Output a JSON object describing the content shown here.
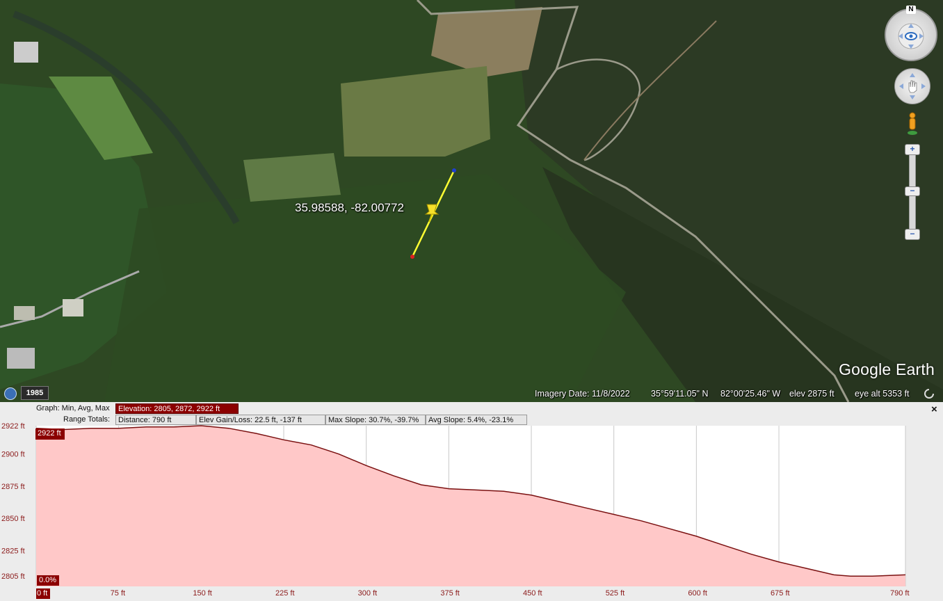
{
  "map": {
    "pin_label": "35.98588, -82.00772",
    "logo": "Google Earth",
    "history_year": "1985",
    "icons": [
      "clock-history-icon",
      "compass-icon",
      "pan-hand-icon",
      "pegman-icon",
      "zoom-in-icon",
      "zoom-out-icon",
      "pushpin-icon",
      "loading-icon"
    ],
    "compass_letter": "N",
    "status": {
      "imagery_date": "Imagery Date: 11/8/2022",
      "lat": "35°59'11.05\" N",
      "lon": "82°00'25.46\" W",
      "elev": "elev  2875 ft",
      "eye_alt": "eye alt   5353 ft"
    }
  },
  "profile": {
    "graph_label": "Graph: Min, Avg, Max",
    "elevation_stats": "Elevation: 2805, 2872, 2922 ft",
    "range_totals_label": "Range Totals:",
    "distance": "Distance: 790 ft",
    "elev_gain_loss": "Elev Gain/Loss: 22.5 ft, -137 ft",
    "max_slope": "Max Slope: 30.7%, -39.7%",
    "avg_slope": "Avg Slope: 5.4%, -23.1%",
    "close_icon": "×",
    "max_marker": "2922 ft",
    "slope_marker": "0.0%",
    "start_marker": "0 ft",
    "colors": {
      "fill": "#ffc8c8",
      "line": "#8b1a1a",
      "highlight": "#8b0000"
    }
  },
  "chart_data": {
    "type": "area",
    "xlabel": "",
    "ylabel": "",
    "xlim": [
      0,
      790
    ],
    "ylim": [
      2797,
      2922
    ],
    "y_ticks": [
      {
        "value": 2922,
        "label": "2922 ft"
      },
      {
        "value": 2900,
        "label": "2900 ft"
      },
      {
        "value": 2875,
        "label": "2875 ft"
      },
      {
        "value": 2850,
        "label": "2850 ft"
      },
      {
        "value": 2825,
        "label": "2825 ft"
      },
      {
        "value": 2805,
        "label": "2805 ft"
      }
    ],
    "x_ticks": [
      {
        "value": 0,
        "label": "0 ft"
      },
      {
        "value": 75,
        "label": "75 ft"
      },
      {
        "value": 150,
        "label": "150 ft"
      },
      {
        "value": 225,
        "label": "225 ft"
      },
      {
        "value": 300,
        "label": "300 ft"
      },
      {
        "value": 375,
        "label": "375 ft"
      },
      {
        "value": 450,
        "label": "450 ft"
      },
      {
        "value": 525,
        "label": "525 ft"
      },
      {
        "value": 600,
        "label": "600 ft"
      },
      {
        "value": 675,
        "label": "675 ft"
      },
      {
        "value": 790,
        "label": "790 ft"
      }
    ],
    "x": [
      0,
      25,
      50,
      75,
      100,
      125,
      150,
      175,
      200,
      225,
      250,
      275,
      300,
      325,
      350,
      375,
      400,
      425,
      450,
      475,
      500,
      525,
      550,
      575,
      600,
      625,
      650,
      675,
      700,
      725,
      740,
      760,
      790
    ],
    "y": [
      2920,
      2919,
      2920,
      2920,
      2921,
      2921,
      2922,
      2920,
      2916,
      2911,
      2907,
      2900,
      2891,
      2883,
      2876,
      2873,
      2872,
      2871,
      2868,
      2863,
      2858,
      2853,
      2848,
      2842,
      2836,
      2829,
      2822,
      2816,
      2811,
      2806,
      2805,
      2805,
      2806
    ]
  }
}
